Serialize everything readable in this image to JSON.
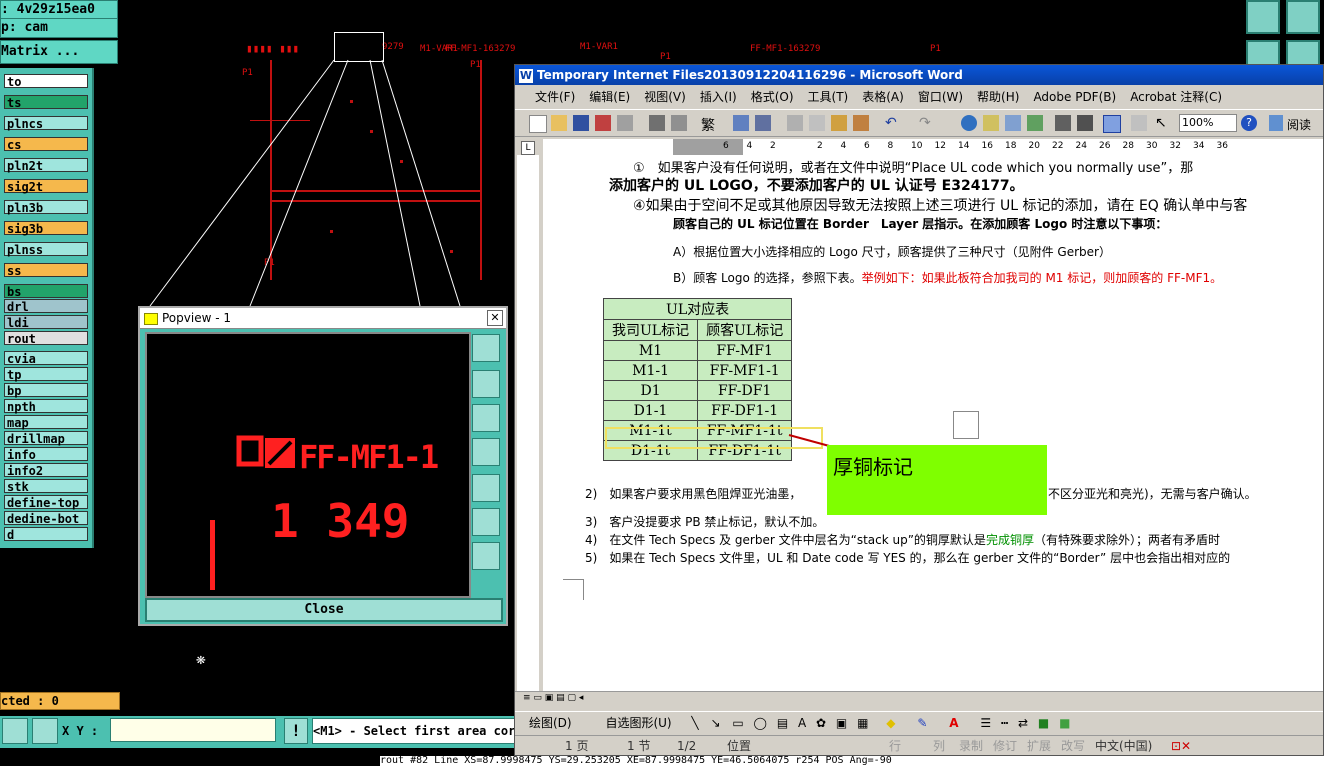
{
  "cam": {
    "job_label": ": 4v29z15ea0",
    "step_label": "p: cam",
    "matrix_label": "Matrix ...",
    "layers": [
      {
        "name": "to",
        "color": "#ffffff"
      },
      {
        "name": "ts",
        "color": "#22a36a"
      },
      {
        "name": "plncs",
        "color": "#9fe5dd"
      },
      {
        "name": "cs",
        "color": "#f5b84c"
      },
      {
        "name": "pln2t",
        "color": "#9fe5dd"
      },
      {
        "name": "sig2t",
        "color": "#f5b84c"
      },
      {
        "name": "pln3b",
        "color": "#9fe5dd"
      },
      {
        "name": "sig3b",
        "color": "#f5b84c"
      },
      {
        "name": "plnss",
        "color": "#9fe5dd"
      },
      {
        "name": "ss",
        "color": "#f5b84c"
      },
      {
        "name": "bs",
        "color": "#22a36a"
      },
      {
        "name": "drl",
        "color": "#9fc4cc"
      },
      {
        "name": "ldi",
        "color": "#9fc4cc"
      },
      {
        "name": "rout",
        "color": "#e0e0e0"
      },
      {
        "name": "cvia",
        "color": "#9fe5dd"
      },
      {
        "name": "tp",
        "color": "#9fe5dd"
      },
      {
        "name": "bp",
        "color": "#9fe5dd"
      },
      {
        "name": "npth",
        "color": "#9fe5dd"
      },
      {
        "name": "map",
        "color": "#9fe5dd"
      },
      {
        "name": "drillmap",
        "color": "#9fe5dd"
      },
      {
        "name": "info",
        "color": "#9fe5dd"
      },
      {
        "name": "info2",
        "color": "#9fe5dd"
      },
      {
        "name": "stk",
        "color": "#9fe5dd"
      },
      {
        "name": "define-top",
        "color": "#9fe5dd"
      },
      {
        "name": "dedine-bot",
        "color": "#9fe5dd"
      },
      {
        "name": "d",
        "color": "#9fe5dd"
      }
    ],
    "selected_label": "cted : 0",
    "xy_label": "X Y :",
    "xy_value": "",
    "prompt": "<M1> - Select first area cor",
    "status_line": "rout #82 Line XS=87.9998475 YS=29.253205 XE=87.9998475 YE=46.5064075 r254 POS Ang=-90"
  },
  "board_texts": {
    "t1": "P1",
    "t2": "P1",
    "t3": "M1-VAR1",
    "t4": "M1-VAR1",
    "t5": "P1",
    "t6": "P1",
    "t7": "P1",
    "t8": "FF-MF1-163279",
    "t9": "FF-MF1-163279",
    "t10": "9279"
  },
  "popview": {
    "title": "Popview - 1",
    "marking": "FF-MF1-1",
    "number": "1 349",
    "close_label": "Close"
  },
  "word": {
    "title": "Temporary Internet Files20130912204116296 - Microsoft Word",
    "menus": [
      "文件(F)",
      "编辑(E)",
      "视图(V)",
      "插入(I)",
      "格式(O)",
      "工具(T)",
      "表格(A)",
      "窗口(W)",
      "帮助(H)",
      "Adobe PDF(B)",
      "Acrobat 注释(C)"
    ],
    "zoom": "100%",
    "read_label": "阅读",
    "ruler_ticks": [
      "6",
      "4",
      "2",
      "",
      "2",
      "4",
      "6",
      "8",
      "10",
      "12",
      "14",
      "16",
      "18",
      "20",
      "22",
      "24",
      "26",
      "28",
      "30",
      "32",
      "34",
      "36"
    ],
    "lines": {
      "l0": "①　如果客户没有任何说明，或者在文件中说明“Place UL code which you normally use”，那",
      "l1": "添加客户的 UL LOGO，不要添加客户的 UL 认证号 E324177。",
      "l2": "④如果由于空间不足或其他原因导致无法按照上述三项进行 UL 标记的添加，请在 EQ 确认单中与客",
      "l3": "顾客自己的 UL 标记位置在 Border　Layer 层指示。在添加顾客 Logo 时注意以下事项：",
      "l4": "A）根据位置大小选择相应的 Logo 尺寸，顾客提供了三种尺寸（见附件 Gerber）",
      "l5a": "B）顾客 Logo 的选择，参照下表。",
      "l5b": "举例如下：如果此板符合加我司的 M1 标记，则加顾客的 FF-MF1。",
      "l6": "2)　如果客户要求用黑色阻焊亚光油墨，",
      "l6b": "不区分亚光和亮光)，无需与客户确认。",
      "l7": "3)　客户没提要求 PB 禁止标记，默认不加。",
      "l8a": "4)　在文件 Tech Specs 及 gerber 文件中层名为“stack up”的铜厚默认是",
      "l8b": "完成铜厚",
      "l8c": "（有特殊要求除外）；两者有矛盾时",
      "l9": "5)　如果在 Tech Specs 文件里，UL 和 Date code 写 YES 的，那么在 gerber 文件的“Border” 层中也会指出相对应的"
    },
    "table": {
      "title": "UL对应表",
      "headers": [
        "我司UL标记",
        "顾客UL标记"
      ],
      "rows": [
        [
          "M1",
          "FF-MF1"
        ],
        [
          "M1-1",
          "FF-MF1-1"
        ],
        [
          "D1",
          "FF-DF1"
        ],
        [
          "D1-1",
          "FF-DF1-1"
        ],
        [
          "M1-1t",
          "FF-MF1-1t"
        ],
        [
          "D1-1t",
          "FF-DF1-1t"
        ]
      ]
    },
    "callout": "厚铜标记",
    "draw_toolbar": {
      "draw": "绘图(D)",
      "autoshape": "自选图形(U)"
    },
    "status": {
      "page": "1 页",
      "section": "1 节",
      "pages": "1/2",
      "position": "位置",
      "line": "行",
      "col": "列",
      "rec": "录制",
      "trk": "修订",
      "ext": "扩展",
      "ovr": "改写",
      "lang": "中文(中国)"
    }
  }
}
